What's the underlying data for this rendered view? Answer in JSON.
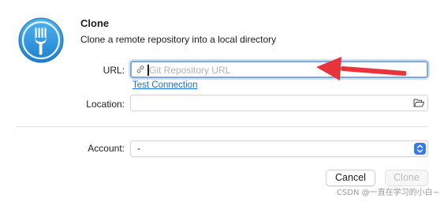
{
  "dialog": {
    "title": "Clone",
    "subtitle": "Clone a remote repository into a local directory"
  },
  "url": {
    "label": "URL:",
    "placeholder": "Git Repository URL",
    "value": "",
    "icon": "link-icon"
  },
  "test_connection": {
    "label": "Test Connection"
  },
  "location": {
    "label": "Location:",
    "value": "",
    "icon": "folder-icon"
  },
  "account": {
    "label": "Account:",
    "value": "-"
  },
  "buttons": {
    "cancel": "Cancel",
    "clone": "Clone"
  },
  "annotation": {
    "arrow_color": "#e8333a"
  },
  "watermark": "CSDN @一直在学习的小白~",
  "colors": {
    "accent": "#3478f6",
    "link": "#1a6fd8",
    "focus_ring": "#7fa7e6"
  }
}
